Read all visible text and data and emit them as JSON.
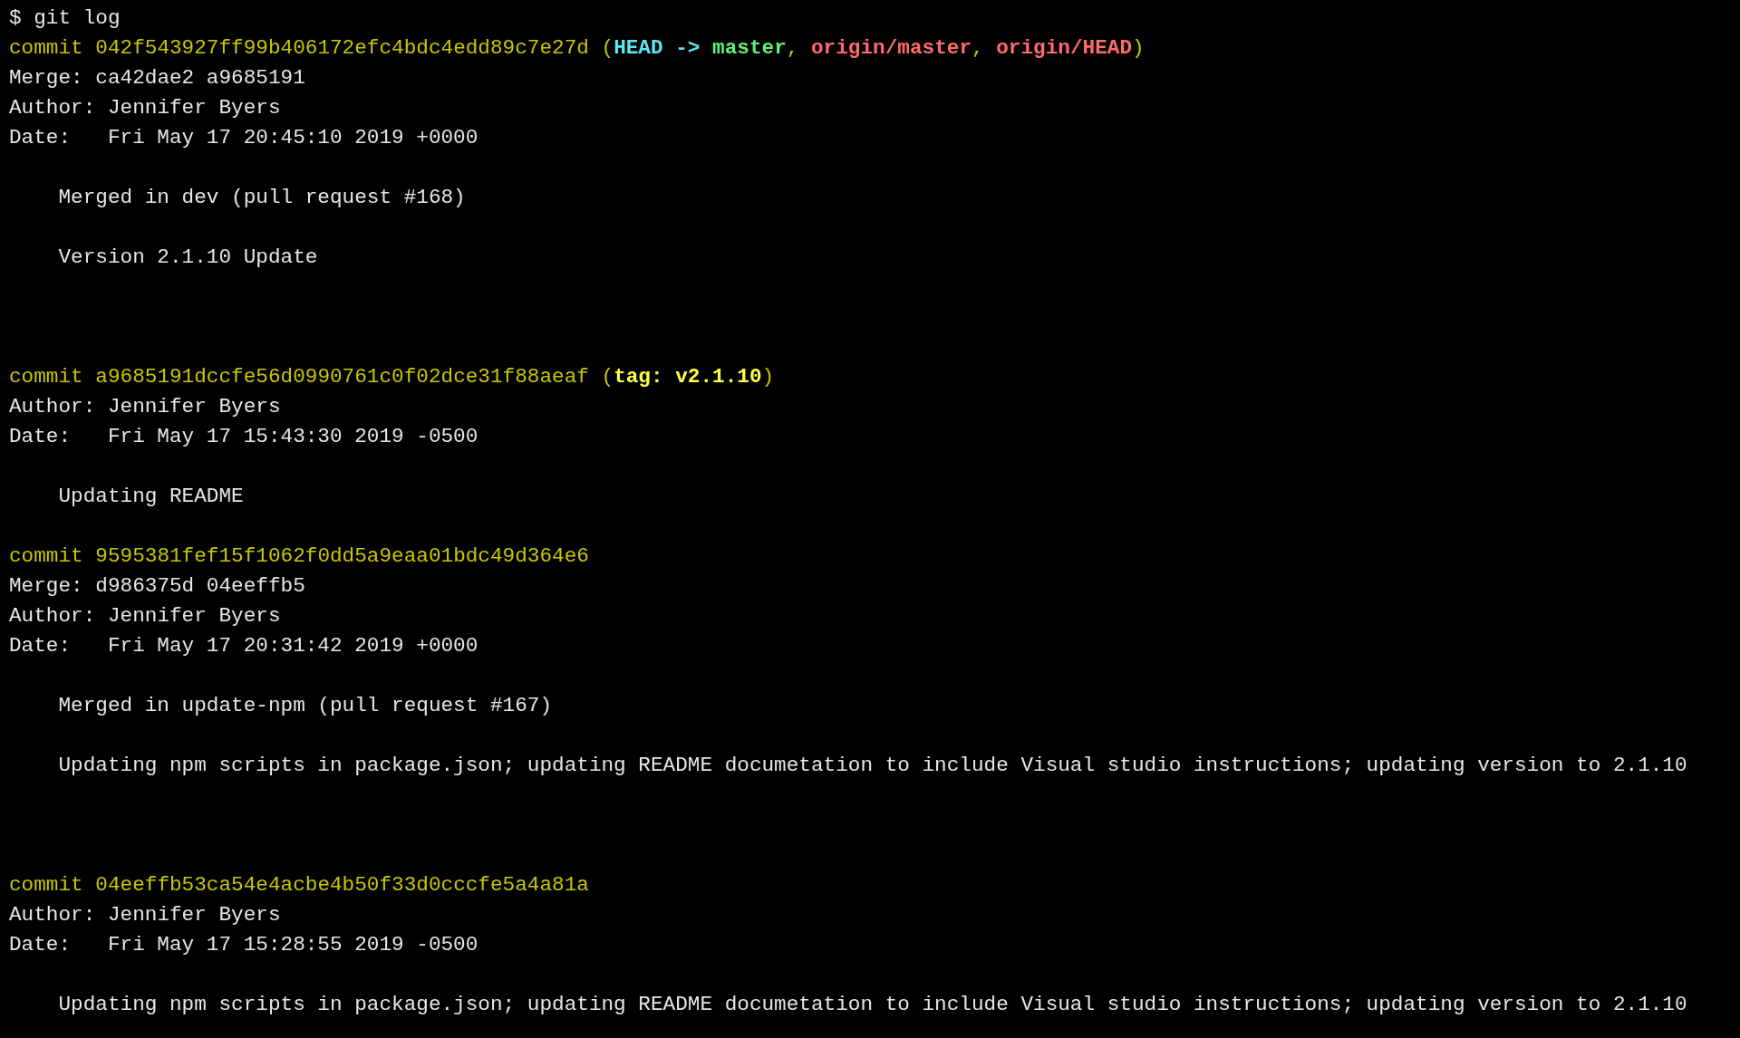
{
  "prompt": {
    "symbol": "$",
    "command": "git log"
  },
  "commits": [
    {
      "label": "commit",
      "hash": "042f543927ff99b406172efc4bdc4edd89c7e27d",
      "refs": {
        "open": "(",
        "close": ")",
        "separator": ",",
        "items": [
          {
            "kind": "head",
            "name": "HEAD",
            "arrow": "->",
            "target": "master"
          },
          {
            "kind": "remote",
            "name": "origin/master"
          },
          {
            "kind": "remote",
            "name": "origin/HEAD"
          }
        ]
      },
      "merge": {
        "label": "Merge:",
        "value": "ca42dae2 a9685191"
      },
      "author": {
        "label": "Author:",
        "value": "Jennifer Byers"
      },
      "date": {
        "label": "Date:",
        "value": "Fri May 17 20:45:10 2019 +0000"
      },
      "message": [
        "Merged in dev (pull request #168)",
        "Version 2.1.10 Update"
      ]
    },
    {
      "label": "commit",
      "hash": "a9685191dccfe56d0990761c0f02dce31f88aeaf",
      "refs": {
        "open": "(",
        "close": ")",
        "items": [
          {
            "kind": "tag",
            "name": "tag: v2.1.10"
          }
        ]
      },
      "author": {
        "label": "Author:",
        "value": "Jennifer Byers"
      },
      "date": {
        "label": "Date:",
        "value": "Fri May 17 15:43:30 2019 -0500"
      },
      "message": [
        "Updating README"
      ]
    },
    {
      "label": "commit",
      "hash": "9595381fef15f1062f0dd5a9eaa01bdc49d364e6",
      "merge": {
        "label": "Merge:",
        "value": "d986375d 04eeffb5"
      },
      "author": {
        "label": "Author:",
        "value": "Jennifer Byers"
      },
      "date": {
        "label": "Date:",
        "value": "Fri May 17 20:31:42 2019 +0000"
      },
      "message": [
        "Merged in update-npm (pull request #167)",
        "Updating npm scripts in package.json; updating README documetation to include Visual studio instructions; updating version to 2.1.10"
      ]
    },
    {
      "label": "commit",
      "hash": "04eeffb53ca54e4acbe4b50f33d0cccfe5a4a81a",
      "author": {
        "label": "Author:",
        "value": "Jennifer Byers"
      },
      "date": {
        "label": "Date:",
        "value": "Fri May 17 15:28:55 2019 -0500"
      },
      "message": [
        "Updating npm scripts in package.json; updating README documetation to include Visual studio instructions; updating version to 2.1.10"
      ]
    }
  ]
}
